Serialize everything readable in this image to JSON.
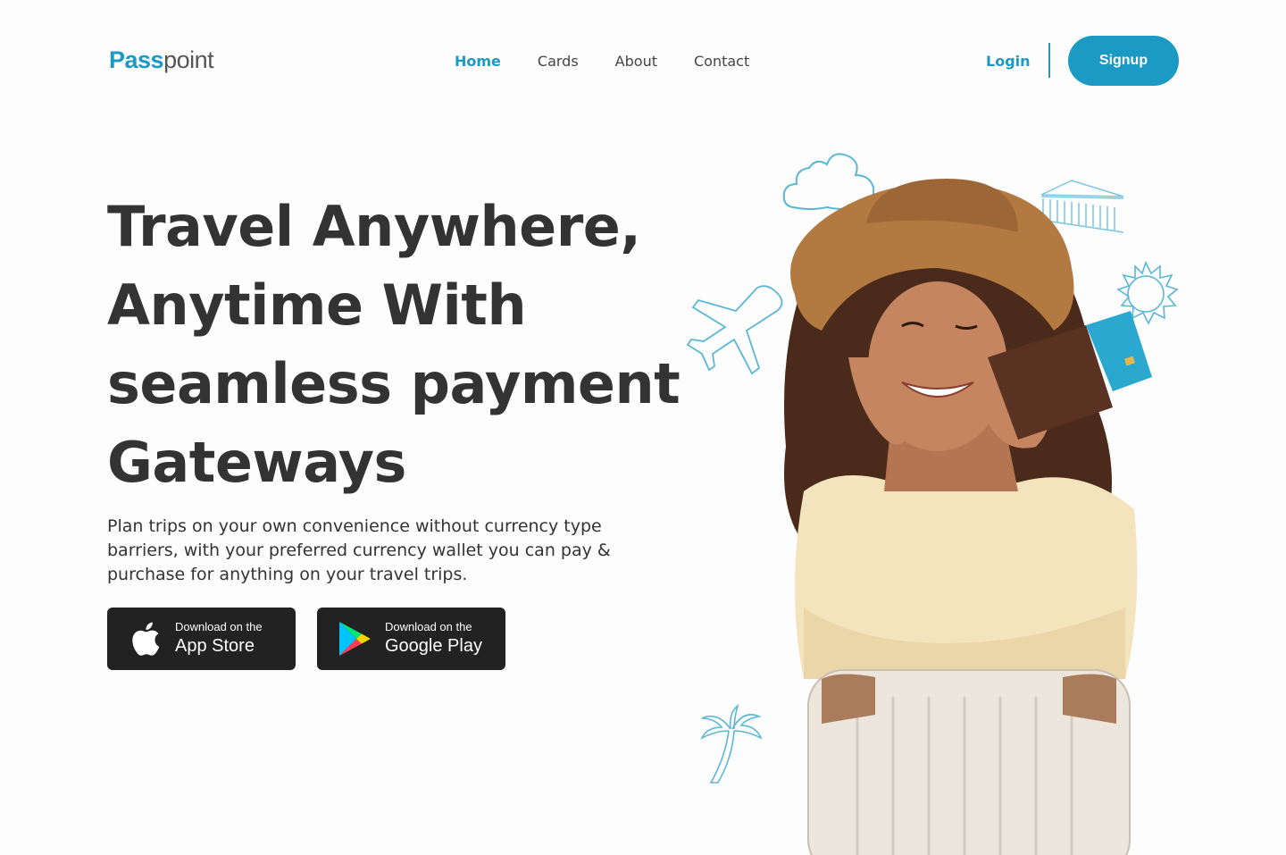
{
  "brand": {
    "part1": "Pass",
    "part2": "point",
    "accent": "#1b9ac4"
  },
  "nav": {
    "items": [
      {
        "label": "Home"
      },
      {
        "label": "Cards"
      },
      {
        "label": "About"
      },
      {
        "label": "Contact"
      }
    ]
  },
  "auth": {
    "login": "Login",
    "signup": "Signup"
  },
  "hero": {
    "title_lines": [
      "Travel Anywhere,",
      "Anytime With",
      "seamless payment",
      "Gateways"
    ],
    "description": "Plan trips on your own convenience without currency type barriers, with your preferred currency wallet you can pay & purchase for anything on your travel trips."
  },
  "stores": {
    "apple": {
      "small": "Download on the",
      "big": "App Store",
      "icon": "apple-icon"
    },
    "google": {
      "small": "Download on the",
      "big": "Google Play",
      "icon": "google-play-icon"
    }
  }
}
